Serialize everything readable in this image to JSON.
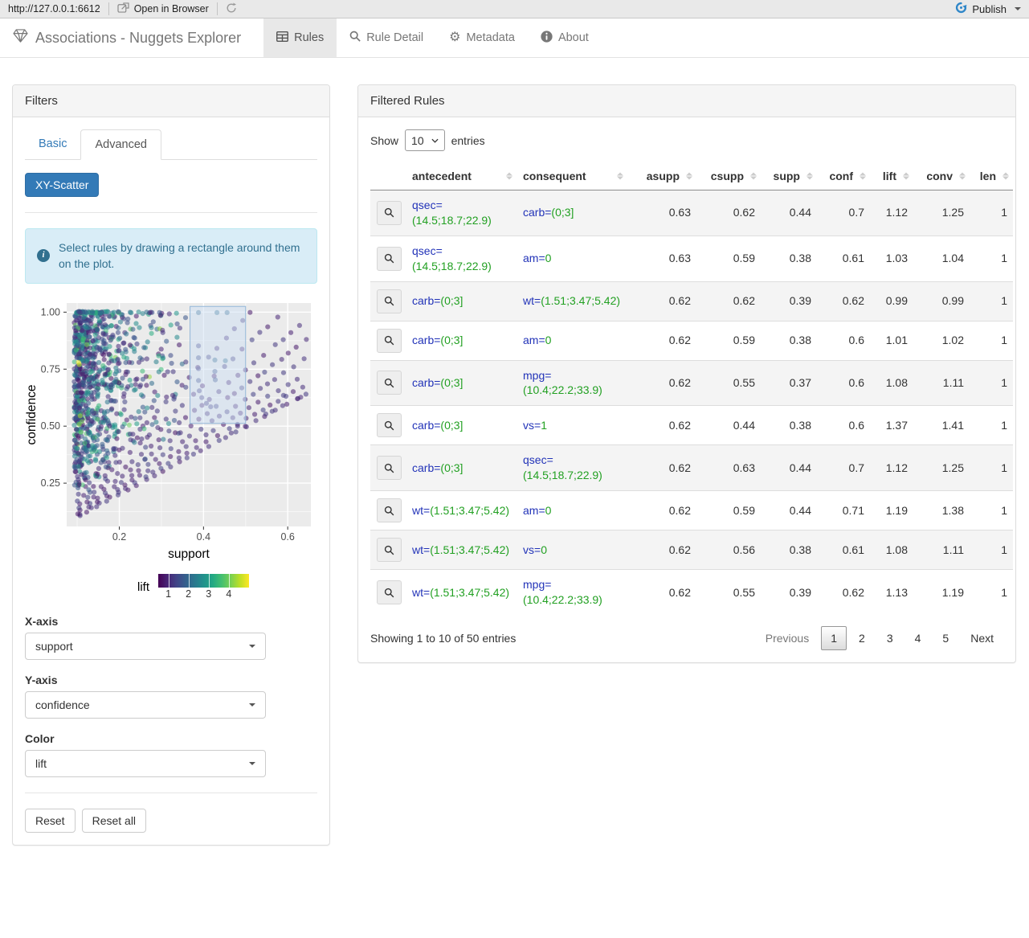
{
  "chrome": {
    "url": "http://127.0.0.1:6612",
    "open_in_browser": "Open in Browser",
    "publish_label": "Publish"
  },
  "navbar": {
    "title": "Associations - Nuggets Explorer",
    "tabs": [
      {
        "label": "Rules",
        "active": true
      },
      {
        "label": "Rule Detail",
        "active": false
      },
      {
        "label": "Metadata",
        "active": false
      },
      {
        "label": "About",
        "active": false
      }
    ]
  },
  "filters": {
    "title": "Filters",
    "tab_basic": "Basic",
    "tab_advanced": "Advanced",
    "scatter_button": "XY-Scatter",
    "info_text": "Select rules by drawing a rectangle around them on the plot.",
    "x_axis_label": "X-axis",
    "x_axis_value": "support",
    "y_axis_label": "Y-axis",
    "y_axis_value": "confidence",
    "color_label": "Color",
    "color_value": "lift",
    "reset": "Reset",
    "reset_all": "Reset all"
  },
  "chart_data": {
    "type": "scatter",
    "xlabel": "support",
    "ylabel": "confidence",
    "x_ticks": [
      0.2,
      0.4,
      0.6
    ],
    "y_ticks": [
      0.25,
      0.5,
      0.75,
      1.0
    ],
    "xlim": [
      0.075,
      0.655
    ],
    "ylim": [
      0.06,
      1.04
    ],
    "panel_color": "#ebebeb",
    "grid_color": "#ffffff",
    "point_opacity": 0.55,
    "point_radius": 3.1,
    "color_legend": {
      "label": "lift",
      "ticks": [
        1,
        2,
        3,
        4
      ],
      "domain": [
        0.5,
        5.0
      ],
      "palette": "viridis",
      "anchors": [
        [
          0,
          "#440154"
        ],
        [
          0.1,
          "#482475"
        ],
        [
          0.2,
          "#414487"
        ],
        [
          0.3,
          "#355f8d"
        ],
        [
          0.4,
          "#2a788e"
        ],
        [
          0.5,
          "#21918c"
        ],
        [
          0.6,
          "#22a884"
        ],
        [
          0.7,
          "#44bf70"
        ],
        [
          0.8,
          "#7ad151"
        ],
        [
          0.9,
          "#bddf26"
        ],
        [
          1,
          "#fde725"
        ]
      ]
    },
    "selection_rect": {
      "x": [
        0.368,
        0.5
      ],
      "y": [
        0.512,
        1.025
      ],
      "fill": "rgba(205,224,243,0.5)",
      "stroke": "#93b7d8"
    },
    "selected_points": [
      [
        0.388,
        0.998,
        2.0
      ],
      [
        0.432,
        0.998,
        2.1
      ],
      [
        0.456,
        0.998,
        2.0
      ],
      [
        0.388,
        0.852,
        1.4
      ],
      [
        0.388,
        0.8,
        1.5
      ],
      [
        0.427,
        0.79,
        2.0
      ],
      [
        0.452,
        0.787,
        2.1
      ],
      [
        0.388,
        0.752,
        1.4
      ],
      [
        0.427,
        0.74,
        1.6
      ],
      [
        0.388,
        0.7,
        1.5
      ],
      [
        0.428,
        0.703,
        1.6
      ],
      [
        0.39,
        0.655,
        1.3
      ],
      [
        0.396,
        0.625,
        1.2
      ],
      [
        0.407,
        0.6,
        1.2
      ],
      [
        0.417,
        0.585,
        1.3
      ]
    ],
    "outlier_points": [
      [
        0.502,
        0.497,
        1.1
      ],
      [
        0.548,
        0.553,
        1.2
      ],
      [
        0.563,
        0.565,
        1.2
      ],
      [
        0.588,
        0.59,
        1.1
      ],
      [
        0.623,
        0.62,
        1.0
      ],
      [
        0.631,
        0.627,
        1.0
      ],
      [
        0.59,
        0.635,
        1.3
      ],
      [
        0.466,
        0.47,
        1.1
      ],
      [
        0.481,
        0.5,
        1.15
      ]
    ],
    "accent_points": [
      [
        0.103,
        0.78,
        4.9
      ],
      [
        0.105,
        0.77,
        4.6
      ],
      [
        0.107,
        0.545,
        4.4
      ],
      [
        0.111,
        0.52,
        4.0
      ],
      [
        0.148,
        0.53,
        3.7
      ],
      [
        0.118,
        0.425,
        3.6
      ],
      [
        0.125,
        0.56,
        3.4
      ]
    ],
    "cloud": {
      "seed": 1337,
      "n": 920,
      "uniform_frac": 0.12,
      "exp_scale": 0.055,
      "top_row_n": 55,
      "diagonal_slopes": [
        1.0,
        1.06,
        1.14,
        1.24,
        1.36,
        1.5,
        1.7,
        1.95
      ]
    }
  },
  "table": {
    "title": "Filtered Rules",
    "show_label": "Show",
    "entries_label": "entries",
    "page_size": "10",
    "columns": [
      "antecedent",
      "consequent",
      "asupp",
      "csupp",
      "supp",
      "conf",
      "lift",
      "conv",
      "len"
    ],
    "rows": [
      {
        "a_attr": "qsec=",
        "a_val": "(14.5;18.7;22.9)",
        "c_attr": "carb=",
        "c_val": "(0;3]",
        "asupp": "0.63",
        "csupp": "0.62",
        "supp": "0.44",
        "conf": "0.7",
        "lift": "1.12",
        "conv": "1.25",
        "len": "1"
      },
      {
        "a_attr": "qsec=",
        "a_val": "(14.5;18.7;22.9)",
        "c_attr": "am=",
        "c_val": "0",
        "asupp": "0.63",
        "csupp": "0.59",
        "supp": "0.38",
        "conf": "0.61",
        "lift": "1.03",
        "conv": "1.04",
        "len": "1"
      },
      {
        "a_attr": "carb=",
        "a_val": "(0;3]",
        "c_attr": "wt=",
        "c_val": "(1.51;3.47;5.42)",
        "asupp": "0.62",
        "csupp": "0.62",
        "supp": "0.39",
        "conf": "0.62",
        "lift": "0.99",
        "conv": "0.99",
        "len": "1"
      },
      {
        "a_attr": "carb=",
        "a_val": "(0;3]",
        "c_attr": "am=",
        "c_val": "0",
        "asupp": "0.62",
        "csupp": "0.59",
        "supp": "0.38",
        "conf": "0.6",
        "lift": "1.01",
        "conv": "1.02",
        "len": "1"
      },
      {
        "a_attr": "carb=",
        "a_val": "(0;3]",
        "c_attr": "mpg=",
        "c_val": "(10.4;22.2;33.9)",
        "asupp": "0.62",
        "csupp": "0.55",
        "supp": "0.37",
        "conf": "0.6",
        "lift": "1.08",
        "conv": "1.11",
        "len": "1"
      },
      {
        "a_attr": "carb=",
        "a_val": "(0;3]",
        "c_attr": "vs=",
        "c_val": "1",
        "asupp": "0.62",
        "csupp": "0.44",
        "supp": "0.38",
        "conf": "0.6",
        "lift": "1.37",
        "conv": "1.41",
        "len": "1"
      },
      {
        "a_attr": "carb=",
        "a_val": "(0;3]",
        "c_attr": "qsec=",
        "c_val": "(14.5;18.7;22.9)",
        "asupp": "0.62",
        "csupp": "0.63",
        "supp": "0.44",
        "conf": "0.7",
        "lift": "1.12",
        "conv": "1.25",
        "len": "1"
      },
      {
        "a_attr": "wt=",
        "a_val": "(1.51;3.47;5.42)",
        "c_attr": "am=",
        "c_val": "0",
        "asupp": "0.62",
        "csupp": "0.59",
        "supp": "0.44",
        "conf": "0.71",
        "lift": "1.19",
        "conv": "1.38",
        "len": "1"
      },
      {
        "a_attr": "wt=",
        "a_val": "(1.51;3.47;5.42)",
        "c_attr": "vs=",
        "c_val": "0",
        "asupp": "0.62",
        "csupp": "0.56",
        "supp": "0.38",
        "conf": "0.61",
        "lift": "1.08",
        "conv": "1.11",
        "len": "1"
      },
      {
        "a_attr": "wt=",
        "a_val": "(1.51;3.47;5.42)",
        "c_attr": "mpg=",
        "c_val": "(10.4;22.2;33.9)",
        "asupp": "0.62",
        "csupp": "0.55",
        "supp": "0.39",
        "conf": "0.62",
        "lift": "1.13",
        "conv": "1.19",
        "len": "1"
      }
    ],
    "info": "Showing 1 to 10 of 50 entries",
    "pagination": {
      "previous": "Previous",
      "pages": [
        "1",
        "2",
        "3",
        "4",
        "5"
      ],
      "current": "1",
      "next": "Next"
    }
  }
}
